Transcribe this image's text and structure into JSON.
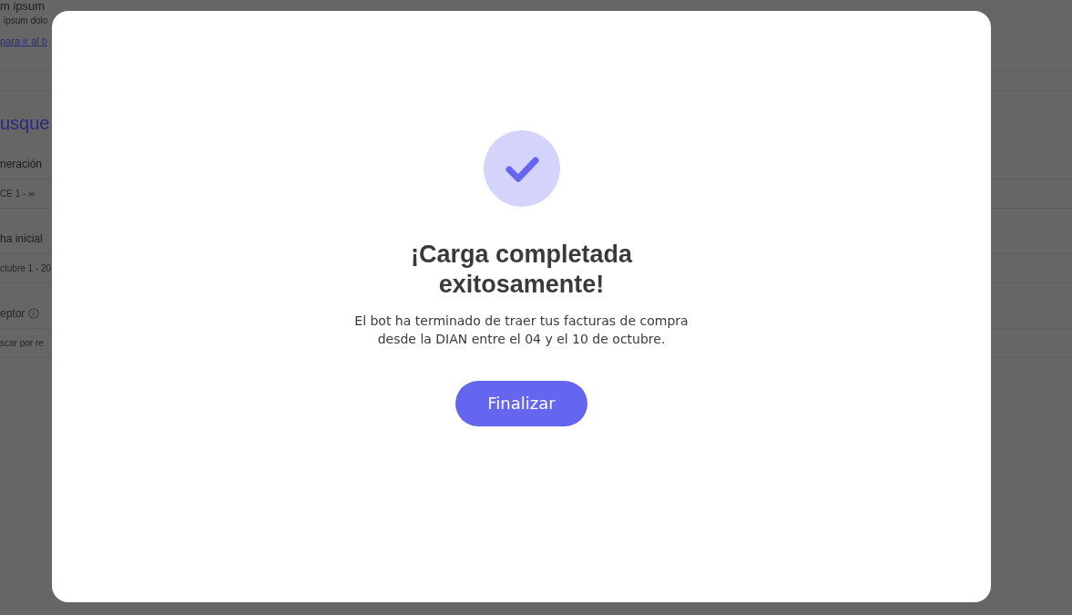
{
  "background_page": {
    "items": [
      {
        "kind": "title",
        "text": "m ipsum"
      },
      {
        "kind": "subtitle",
        "text": "ipsum dolo"
      },
      {
        "kind": "link",
        "text": "para ir al b"
      },
      {
        "kind": "heading",
        "text": "usque"
      },
      {
        "kind": "label",
        "text": "neración"
      },
      {
        "kind": "value",
        "text": "CE 1 - ∞"
      },
      {
        "kind": "label",
        "text": "ha inicial"
      },
      {
        "kind": "value",
        "text": "ctubre 1 - 20"
      },
      {
        "kind": "info_label",
        "text": "eptor"
      },
      {
        "kind": "value",
        "text": "scar por re"
      }
    ]
  },
  "modal": {
    "title": "¡Carga completada exitosamente!",
    "message": "El bot ha terminado de traer tus facturas de compra desde la DIAN entre el 04 y el 10 de octubre.",
    "button": "Finalizar"
  }
}
